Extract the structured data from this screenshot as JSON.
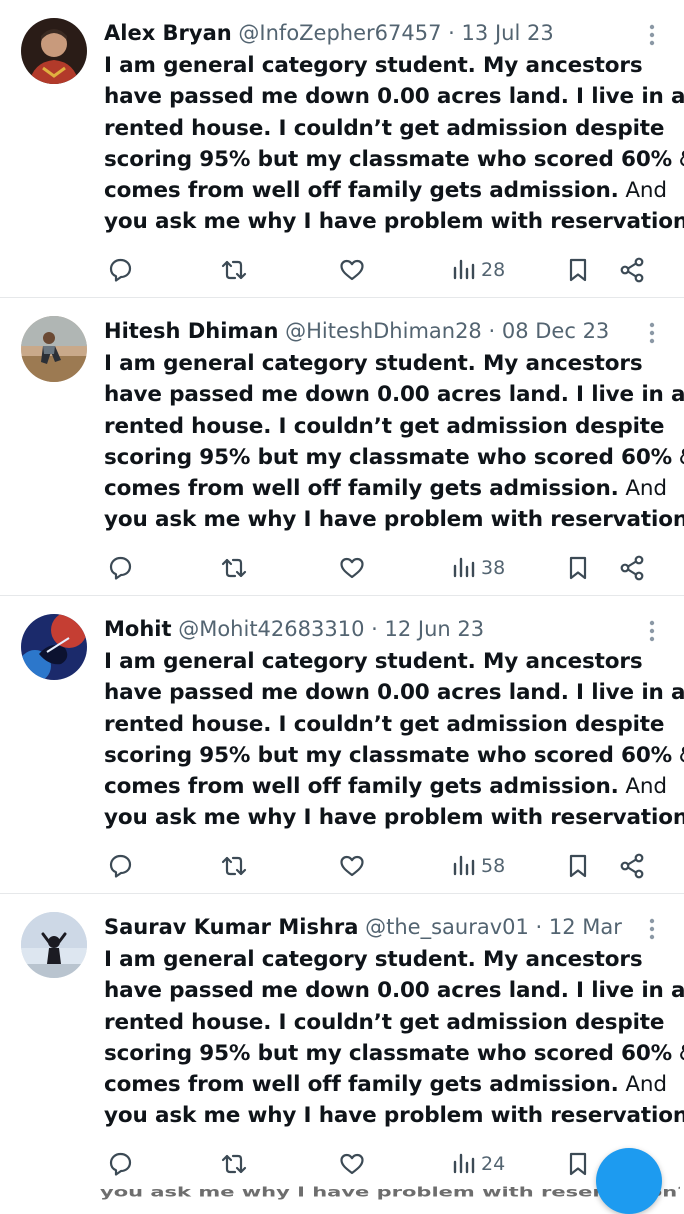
{
  "tweets": [
    {
      "name": "Alex Bryan",
      "handle": "@InfoZepher67457",
      "date": "13 Jul 23",
      "views": "28",
      "lines": [
        {
          "b": "I am general category student. My ancestors",
          "n": ""
        },
        {
          "b": "have passed me down 0.00 acres land. I live in a",
          "n": ""
        },
        {
          "b": "rented house. I couldn’t get admission despite",
          "n": ""
        },
        {
          "b": "scoring 95% but my classmate who scored 60%",
          "n": " &"
        },
        {
          "b": "comes from well off family gets admission.",
          "n": " And"
        },
        {
          "b": "you ask me why I have problem with reservation",
          "n": "?"
        }
      ]
    },
    {
      "name": "Hitesh Dhiman",
      "handle": "@HiteshDhiman28",
      "date": "08 Dec 23",
      "views": "38",
      "lines": [
        {
          "b": "I am general category student. My ancestors",
          "n": ""
        },
        {
          "b": "have passed me down 0.00 acres land. I live in a",
          "n": ""
        },
        {
          "b": "rented house. I couldn’t get admission despite",
          "n": ""
        },
        {
          "b": "scoring 95% but my classmate who scored 60%",
          "n": " &"
        },
        {
          "b": "comes from well off family gets admission.",
          "n": " And"
        },
        {
          "b": "you ask me why I have problem with reservation",
          "n": "?"
        }
      ]
    },
    {
      "name": "Mohit",
      "handle": "@Mohit42683310",
      "date": "12 Jun 23",
      "views": "58",
      "lines": [
        {
          "b": "I am general category student. My ancestors",
          "n": ""
        },
        {
          "b": "have passed me down 0.00 acres land. I live in a",
          "n": ""
        },
        {
          "b": "rented house. I couldn’t get admission despite",
          "n": ""
        },
        {
          "b": "scoring 95% but my classmate who scored 60%",
          "n": " &"
        },
        {
          "b": "comes from well off family gets admission.",
          "n": " And"
        },
        {
          "b": "you ask me why I have problem with reservation",
          "n": "?"
        }
      ]
    },
    {
      "name": "Saurav Kumar Mishra",
      "handle": "@the_saurav01",
      "date": "12 Mar",
      "views": "24",
      "lines": [
        {
          "b": "I am general category student. My ancestors",
          "n": ""
        },
        {
          "b": "have passed me down 0.00 acres land. I live in a",
          "n": ""
        },
        {
          "b": "rented house. I couldn’t get admission despite",
          "n": ""
        },
        {
          "b": "scoring 95% but my classmate who scored 60%",
          "n": " &"
        },
        {
          "b": "comes from well off family gets admission.",
          "n": " And"
        },
        {
          "b": "you ask me why I have problem with reservation",
          "n": "?"
        }
      ]
    }
  ],
  "separator": "·",
  "bleed_text": "you ask me why I have problem with reservation?",
  "colors": {
    "accent": "#1d9bf0",
    "text": "#0f1419",
    "muted": "#536471",
    "divider": "#e6e8ea"
  }
}
